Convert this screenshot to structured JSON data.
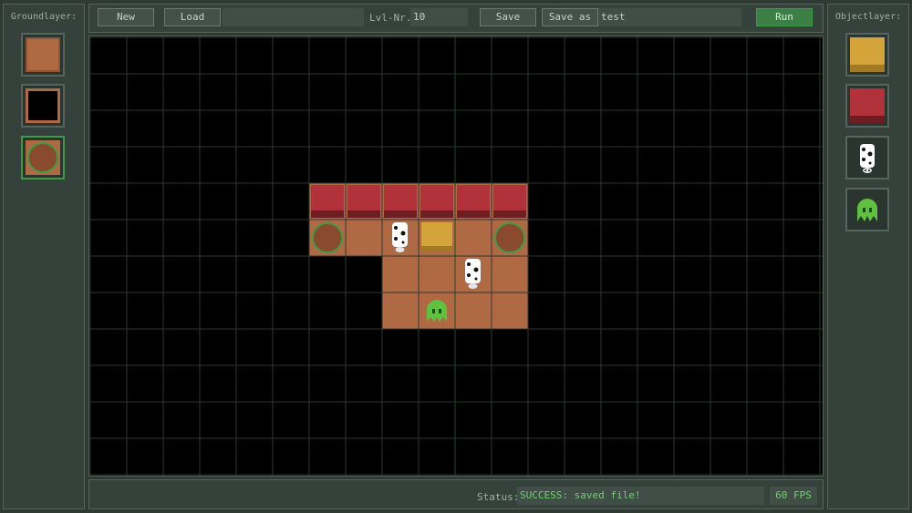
{
  "left_panel": {
    "title": "Groundlayer:",
    "tiles": [
      {
        "name": "floor-tile-icon",
        "color": "#b06a43"
      },
      {
        "name": "pit-tile-icon",
        "color": "#000000"
      },
      {
        "name": "target-tile-icon",
        "color": "#b06a43",
        "ring": "#3f9a45"
      }
    ]
  },
  "right_panel": {
    "title": "Objectlayer:",
    "tiles": [
      {
        "name": "yellow-crate-icon",
        "color": "#d4a43a"
      },
      {
        "name": "red-wall-icon",
        "color": "#b1323a"
      },
      {
        "name": "cow-icon"
      },
      {
        "name": "green-alien-icon",
        "color": "#5ec13f"
      }
    ]
  },
  "toolbar": {
    "new_label": "New",
    "load_label": "Load",
    "load_path": "",
    "level_label": "Lvl-Nr.:",
    "level_value": "10",
    "save_label": "Save",
    "save_as_label": "Save as",
    "filename": "test",
    "run_label": "Run"
  },
  "status": {
    "label": "Status:",
    "message": "SUCCESS: saved file!",
    "fps": "60 FPS"
  },
  "colors": {
    "floor": "#b06a43",
    "wall_red": "#b1323a",
    "crate_yellow": "#d4a43a",
    "target_ring": "#3f9a45",
    "alien_green": "#5ec13f",
    "grid_line": "#2e3833",
    "center_line": "#1f4a24"
  },
  "board": {
    "floor_cells": [
      [
        6,
        4
      ],
      [
        7,
        4
      ],
      [
        8,
        4
      ],
      [
        9,
        4
      ],
      [
        10,
        4
      ],
      [
        11,
        4
      ],
      [
        6,
        5
      ],
      [
        7,
        5
      ],
      [
        8,
        5
      ],
      [
        9,
        5
      ],
      [
        10,
        5
      ],
      [
        11,
        5
      ],
      [
        8,
        6
      ],
      [
        9,
        6
      ],
      [
        10,
        6
      ],
      [
        11,
        6
      ],
      [
        8,
        7
      ],
      [
        9,
        7
      ],
      [
        10,
        7
      ],
      [
        11,
        7
      ]
    ],
    "targets": [
      [
        6,
        5
      ],
      [
        11,
        5
      ]
    ],
    "walls": [
      [
        6,
        4
      ],
      [
        7,
        4
      ],
      [
        8,
        4
      ],
      [
        9,
        4
      ],
      [
        10,
        4
      ],
      [
        11,
        4
      ]
    ],
    "crates": [
      [
        9,
        5
      ]
    ],
    "cows": [
      [
        8,
        5
      ],
      [
        10,
        6
      ]
    ],
    "aliens": [
      [
        9,
        7
      ]
    ]
  }
}
